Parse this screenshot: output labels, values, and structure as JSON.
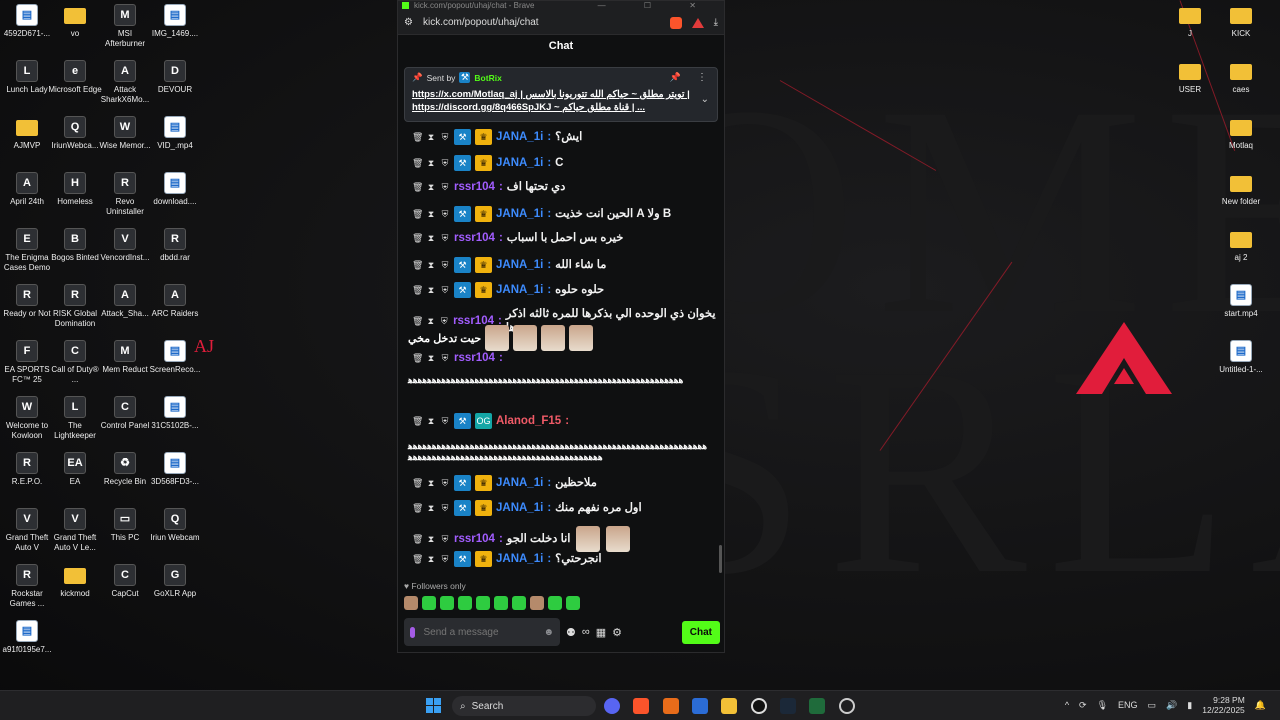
{
  "wallpaper": {
    "letters": "OME\nSRLA",
    "accent": "#9d1b2a"
  },
  "desktop": {
    "icons": [
      {
        "label": "4592D671-...",
        "glyph": "▤",
        "kind": "doc"
      },
      {
        "label": "vo",
        "glyph": "",
        "kind": "folder"
      },
      {
        "label": "MSI Afterburner",
        "glyph": "M",
        "kind": "app"
      },
      {
        "label": "IMG_1469....",
        "glyph": "▤",
        "kind": "doc"
      },
      {
        "label": "Lunch Lady",
        "glyph": "L",
        "kind": "app"
      },
      {
        "label": "Microsoft Edge",
        "glyph": "e",
        "kind": "app"
      },
      {
        "label": "Attack SharkX6Mo...",
        "glyph": "A",
        "kind": "app"
      },
      {
        "label": "DEVOUR",
        "glyph": "D",
        "kind": "app"
      },
      {
        "label": "AJMVP",
        "glyph": "",
        "kind": "folder"
      },
      {
        "label": "IriunWebca...",
        "glyph": "Q",
        "kind": "app"
      },
      {
        "label": "Wise Memor...",
        "glyph": "W",
        "kind": "app"
      },
      {
        "label": "VID_.mp4",
        "glyph": "▤",
        "kind": "doc"
      },
      {
        "label": "April 24th",
        "glyph": "A",
        "kind": "app"
      },
      {
        "label": "Homeless",
        "glyph": "H",
        "kind": "app"
      },
      {
        "label": "Revo Uninstaller",
        "glyph": "R",
        "kind": "app"
      },
      {
        "label": "download....",
        "glyph": "▤",
        "kind": "doc"
      },
      {
        "label": "The Enigma Cases Demo",
        "glyph": "E",
        "kind": "app"
      },
      {
        "label": "Bogos Binted",
        "glyph": "B",
        "kind": "app"
      },
      {
        "label": "VencordInst...",
        "glyph": "V",
        "kind": "app"
      },
      {
        "label": "dbdd.rar",
        "glyph": "R",
        "kind": "app"
      },
      {
        "label": "Ready or Not",
        "glyph": "R",
        "kind": "app"
      },
      {
        "label": "RISK Global Domination",
        "glyph": "R",
        "kind": "app"
      },
      {
        "label": "Attack_Sha...",
        "glyph": "A",
        "kind": "app"
      },
      {
        "label": "ARC Raiders",
        "glyph": "A",
        "kind": "app"
      },
      {
        "label": "EA SPORTS FC™ 25",
        "glyph": "F",
        "kind": "app"
      },
      {
        "label": "Call of Duty® ...",
        "glyph": "C",
        "kind": "app"
      },
      {
        "label": "Mem Reduct",
        "glyph": "M",
        "kind": "app"
      },
      {
        "label": "ScreenReco...",
        "glyph": "▤",
        "kind": "doc"
      },
      {
        "label": "Welcome to Kowloon",
        "glyph": "W",
        "kind": "app"
      },
      {
        "label": "The Lightkeeper",
        "glyph": "L",
        "kind": "app"
      },
      {
        "label": "Control Panel",
        "glyph": "C",
        "kind": "app"
      },
      {
        "label": "31C5102B-...",
        "glyph": "▤",
        "kind": "doc"
      },
      {
        "label": "R.E.P.O.",
        "glyph": "R",
        "kind": "app"
      },
      {
        "label": "EA",
        "glyph": "EA",
        "kind": "app"
      },
      {
        "label": "Recycle Bin",
        "glyph": "♻",
        "kind": "app"
      },
      {
        "label": "3D568FD3-...",
        "glyph": "▤",
        "kind": "doc"
      },
      {
        "label": "Grand Theft Auto V",
        "glyph": "V",
        "kind": "app"
      },
      {
        "label": "Grand Theft Auto V Le...",
        "glyph": "V",
        "kind": "app"
      },
      {
        "label": "This PC",
        "glyph": "▭",
        "kind": "app"
      },
      {
        "label": "Iriun Webcam",
        "glyph": "Q",
        "kind": "app"
      },
      {
        "label": "Rockstar Games ...",
        "glyph": "R",
        "kind": "app"
      },
      {
        "label": "kickmod",
        "glyph": "",
        "kind": "folder"
      },
      {
        "label": "CapCut",
        "glyph": "C",
        "kind": "app"
      },
      {
        "label": "GoXLR App",
        "glyph": "G",
        "kind": "app"
      },
      {
        "label": "a91f0195e7...",
        "glyph": "▤",
        "kind": "doc"
      },
      {
        "label": "J",
        "glyph": "",
        "kind": "folder"
      },
      {
        "label": "KICK",
        "glyph": "",
        "kind": "folder"
      },
      {
        "label": "USER",
        "glyph": "",
        "kind": "folder"
      },
      {
        "label": "caes",
        "glyph": "",
        "kind": "folder"
      },
      {
        "label": "Motlaq",
        "glyph": "",
        "kind": "folder"
      },
      {
        "label": "New folder",
        "glyph": "",
        "kind": "folder"
      },
      {
        "label": "aj 2",
        "glyph": "",
        "kind": "folder"
      },
      {
        "label": "start.mp4",
        "glyph": "▤",
        "kind": "doc"
      },
      {
        "label": "Untitled-1-...",
        "glyph": "▤",
        "kind": "doc"
      }
    ]
  },
  "browser": {
    "title": "kick.com/popout/uhaj/chat - Brave",
    "url": "kick.com/popout/uhaj/chat",
    "header": "Chat",
    "pinned": {
      "sent_by": "Sent by",
      "bot": "BotRix",
      "line1": "https://x.com/Motlaq_aj | تويتر مطلق ~ حياكم الله تتوريونا بالاسس |",
      "line2": "https://discord.gg/8q466SpJKJ ~ قناة مطلق حياكم | ..."
    },
    "messages": [
      {
        "user": "JANA_1i",
        "cls": "u-jana",
        "badges": [
          "mod",
          "vip"
        ],
        "text": "ايش؟"
      },
      {
        "user": "JANA_1i",
        "cls": "u-jana",
        "badges": [
          "mod",
          "vip"
        ],
        "text": "C"
      },
      {
        "user": "rssr104",
        "cls": "u-rssr",
        "badges": [],
        "text": "دي تحتها اف"
      },
      {
        "user": "JANA_1i",
        "cls": "u-jana",
        "badges": [
          "mod",
          "vip"
        ],
        "text": "الحين انت خذيت A ولا B"
      },
      {
        "user": "rssr104",
        "cls": "u-rssr",
        "badges": [],
        "text": "خيره بس احمل با اسباب"
      },
      {
        "user": "JANA_1i",
        "cls": "u-jana",
        "badges": [
          "mod",
          "vip"
        ],
        "text": "ما شاء الله"
      },
      {
        "user": "JANA_1i",
        "cls": "u-jana",
        "badges": [
          "mod",
          "vip"
        ],
        "text": "حلوه حلوه"
      },
      {
        "user": "rssr104",
        "cls": "u-rssr",
        "badges": [],
        "text": "يخوان ذي الوحده الي بذكرها للمره ثالثه اذكر ها"
      },
      {
        "user": "rssr104",
        "cls": "u-rssr",
        "badges": [],
        "text": ""
      },
      {
        "user": "Alanod_F15",
        "cls": "u-alanod",
        "badges": [
          "mod",
          "og"
        ],
        "text": ""
      },
      {
        "user": "JANA_1i",
        "cls": "u-jana",
        "badges": [
          "mod",
          "vip"
        ],
        "text": "ملاحظين"
      },
      {
        "user": "JANA_1i",
        "cls": "u-jana",
        "badges": [
          "mod",
          "vip"
        ],
        "text": "اول مره نفهم منك"
      },
      {
        "user": "rssr104",
        "cls": "u-rssr",
        "badges": [],
        "text": "انا دخلت الجو"
      },
      {
        "user": "JANA_1i",
        "cls": "u-jana",
        "badges": [
          "mod",
          "vip"
        ],
        "text": "انجرحتي؟"
      }
    ],
    "wrap_line": "حيت تدخل مخي",
    "long_text_1": "ﻫﻫﻫﻫﻫﻫﻫﻫﻫﻫﻫﻫﻫﻫﻫﻫﻫﻫﻫﻫﻫﻫﻫﻫﻫﻫﻫﻫﻫﻫﻫﻫﻫﻫﻫﻫﻫﻫﻫﻫﻫﻫﻫﻫﻫﻫﻫﻫﻫﻫﻫﻫﻫﻫﻫﻫﻫﻫ",
    "long_text_2": "ﻫﻫﻫﻫﻫﻫﻫﻫﻫﻫﻫﻫﻫﻫﻫﻫﻫﻫﻫﻫﻫﻫﻫﻫﻫﻫﻫﻫﻫﻫﻫﻫﻫﻫﻫﻫﻫﻫﻫﻫﻫﻫﻫﻫﻫﻫﻫﻫﻫﻫﻫﻫﻫﻫﻫﻫﻫﻫﻫﻫﻫﻫﻫﻫﻫﻫﻫﻫﻫﻫﻫﻫﻫﻫﻫﻫﻫﻫﻫﻫﻫﻫﻫﻫﻫﻫﻫﻫﻫﻫﻫﻫﻫﻫﻫﻫﻫﻫﻫﻫﻫﻫﻫﻫ",
    "followers_only": "Followers only",
    "input_placeholder": "Send a message",
    "chat_button": "Chat",
    "accent": "#53fc18"
  },
  "taskbar": {
    "search": "Search",
    "lang": "ENG",
    "time": "9:28 PM",
    "date": "12/22/2025"
  }
}
